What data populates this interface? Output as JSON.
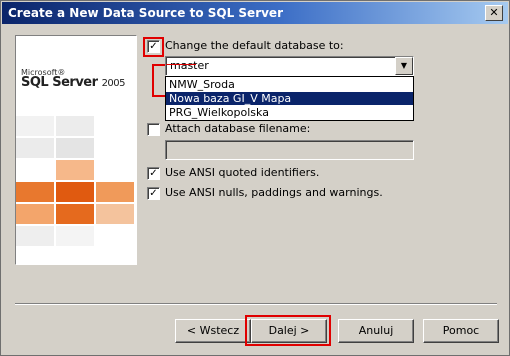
{
  "window": {
    "title": "Create a New Data Source to SQL Server",
    "close_glyph": "✕"
  },
  "branding": {
    "microsoft": "Microsoft®",
    "product": "SQL Server",
    "year": "2005"
  },
  "options": {
    "change_db": {
      "label": "Change the default database to:",
      "checked": true
    },
    "database_combo": {
      "value": "master",
      "arrow_glyph": "▼"
    },
    "dropdown_items": [
      "NMW_Sroda",
      "Nowa baza GI_V Mapa",
      "PRG_Wielkopolska"
    ],
    "attach_db": {
      "label": "Attach database filename:",
      "checked": false
    },
    "ansi_quoted": {
      "label": "Use ANSI quoted identifiers.",
      "checked": true
    },
    "ansi_nulls": {
      "label": "Use ANSI nulls, paddings and warnings.",
      "checked": true
    }
  },
  "buttons": {
    "back": "< Wstecz",
    "next": "Dalej >",
    "cancel": "Anuluj",
    "help": "Pomoc"
  },
  "colors": {
    "accent_red": "#e00000",
    "selection_blue": "#0a246a",
    "orange": "#e8782e"
  }
}
